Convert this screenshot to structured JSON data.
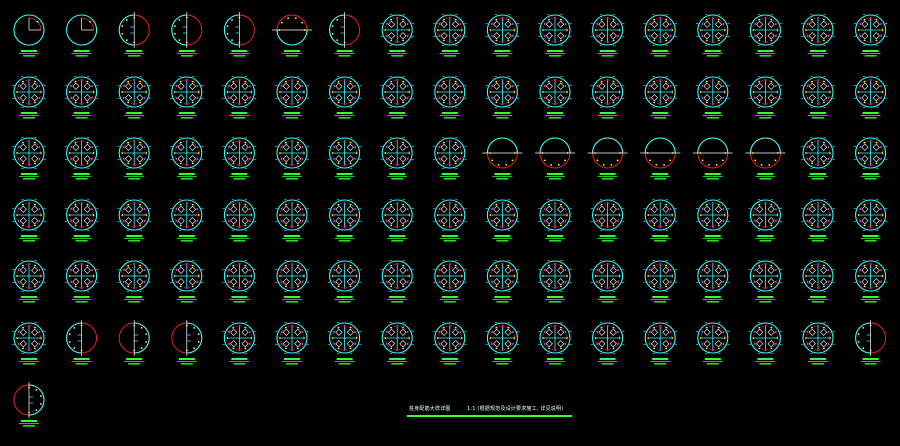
{
  "drawing": {
    "background": "#000000",
    "layer_colors": {
      "ring": "#33ffff",
      "diameter_circle": "#ff2222",
      "ties": "#ffffff",
      "rebar_dots": "#ff44ff",
      "dimension_marks": "#ffff33",
      "labels": "#33ff33"
    },
    "detail_count": 103,
    "rows": [
      [
        "single-arc",
        "single-arc",
        "half-circle-right",
        "half-circle-right",
        "half-circle-right",
        "half-circle-top",
        "half-circle-right",
        "full",
        "full",
        "full",
        "full",
        "full",
        "full",
        "full",
        "full",
        "full",
        "full"
      ],
      [
        "full",
        "full",
        "full",
        "full",
        "full",
        "full",
        "full",
        "full",
        "full",
        "full",
        "full",
        "full",
        "full",
        "full",
        "full",
        "full",
        "full"
      ],
      [
        "full",
        "full",
        "full",
        "full",
        "full",
        "full",
        "full",
        "full",
        "full",
        "half-circle-bottom",
        "half-circle-bottom",
        "half-circle-bottom",
        "half-circle-bottom",
        "half-circle-bottom",
        "half-circle-bottom",
        "full",
        "full"
      ],
      [
        "full",
        "full",
        "full",
        "full",
        "full",
        "full",
        "full",
        "full",
        "full",
        "full",
        "full",
        "full",
        "full",
        "full",
        "full",
        "full",
        "full"
      ],
      [
        "full",
        "full",
        "full",
        "full",
        "full",
        "full",
        "full",
        "full",
        "full",
        "full",
        "full",
        "full",
        "full",
        "full",
        "full",
        "full",
        "full"
      ],
      [
        "full",
        "half-circle-right",
        "half-circle-left",
        "half-circle-left",
        "full",
        "full",
        "full",
        "full",
        "full",
        "full",
        "full",
        "full",
        "full",
        "full",
        "full",
        "full",
        "half-circle-right"
      ],
      [
        "half-circle-left"
      ]
    ]
  },
  "title_block": {
    "left_text": "桩身配筋大样详图",
    "right_text": "1:1 (根据规范及设计要求施工, 详见说明)",
    "underline_color": "#33ff33"
  }
}
